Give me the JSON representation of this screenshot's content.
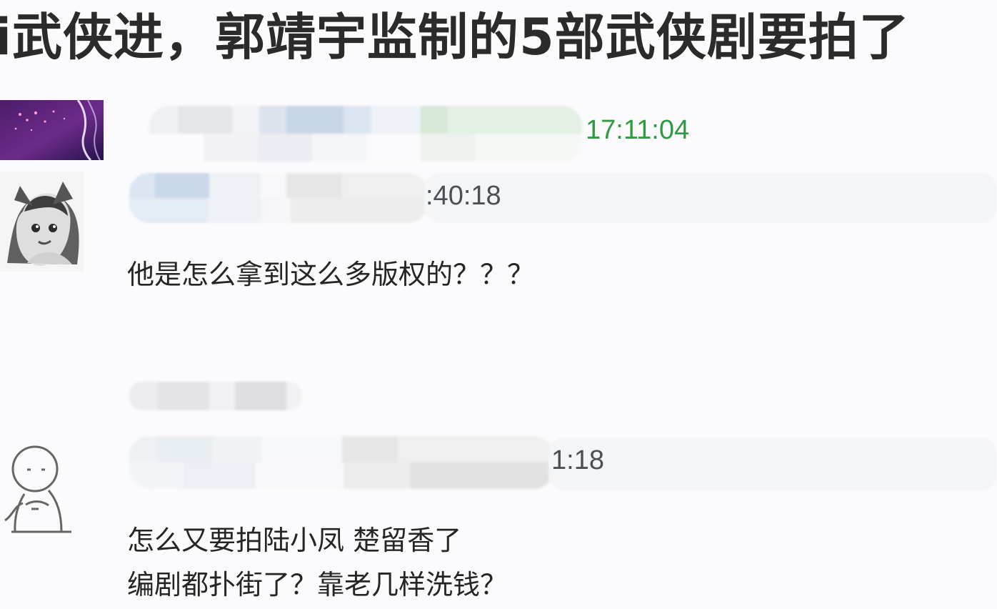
{
  "headline": "i武侠进，郭靖宇监制的5部武侠剧要拍了",
  "colors": {
    "accent_time": "#2f9b40",
    "muted_time": "#4b4f56"
  },
  "messages": [
    {
      "time": "17:11:04",
      "avatar": "purple-space-avatar"
    },
    {
      "time": ":40:18",
      "avatar": "anime-character-avatar",
      "comment": "他是怎么拿到这么多版权的？？？"
    },
    {
      "time": "1:18",
      "avatar": "doodle-stick-figure-avatar",
      "comment_lines": [
        "怎么又要拍陆小凤 楚留香了",
        "编剧都扑街了？靠老几样洗钱？"
      ]
    }
  ]
}
